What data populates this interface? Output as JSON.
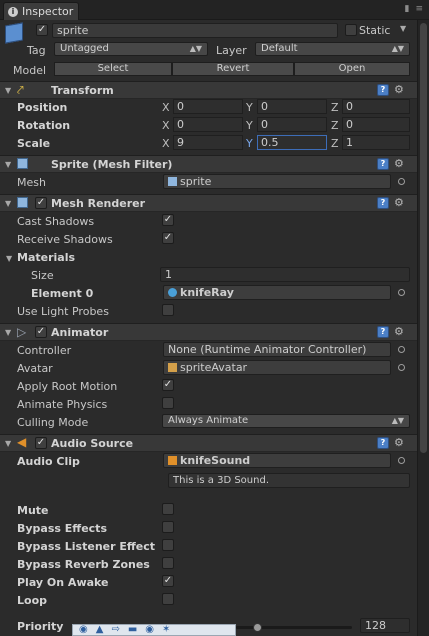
{
  "tab": {
    "title": "Inspector"
  },
  "object": {
    "name": "sprite",
    "active": true,
    "static_label": "Static",
    "static_checked": false,
    "tag_label": "Tag",
    "tag_value": "Untagged",
    "layer_label": "Layer",
    "layer_value": "Default",
    "model_label": "Model",
    "model_buttons": [
      "Select",
      "Revert",
      "Open"
    ]
  },
  "transform": {
    "title": "Transform",
    "position_label": "Position",
    "rotation_label": "Rotation",
    "scale_label": "Scale",
    "axes": [
      "X",
      "Y",
      "Z"
    ],
    "position": [
      "0",
      "0",
      "0"
    ],
    "rotation": [
      "0",
      "0",
      "0"
    ],
    "scale": [
      "9",
      "0.5",
      "1"
    ]
  },
  "mesh_filter": {
    "title": "Sprite (Mesh Filter)",
    "mesh_label": "Mesh",
    "mesh_value": "sprite"
  },
  "mesh_renderer": {
    "title": "Mesh Renderer",
    "enabled": true,
    "cast_shadows_label": "Cast Shadows",
    "cast_shadows": true,
    "receive_shadows_label": "Receive Shadows",
    "receive_shadows": true,
    "materials_label": "Materials",
    "size_label": "Size",
    "size_value": "1",
    "element0_label": "Element 0",
    "element0_value": "knifeRay",
    "light_probes_label": "Use Light Probes",
    "light_probes": false
  },
  "animator": {
    "title": "Animator",
    "enabled": true,
    "controller_label": "Controller",
    "controller_value": "None (Runtime Animator Controller)",
    "avatar_label": "Avatar",
    "avatar_value": "spriteAvatar",
    "apply_root_motion_label": "Apply Root Motion",
    "apply_root_motion": true,
    "animate_physics_label": "Animate Physics",
    "animate_physics": false,
    "culling_mode_label": "Culling Mode",
    "culling_mode_value": "Always Animate"
  },
  "audio_source": {
    "title": "Audio Source",
    "enabled": true,
    "audio_clip_label": "Audio Clip",
    "audio_clip_value": "knifeSound",
    "clip_info": "This is a 3D Sound.",
    "mute_label": "Mute",
    "mute": false,
    "bypass_effects_label": "Bypass Effects",
    "bypass_effects": false,
    "bypass_listener_label": "Bypass Listener Effect",
    "bypass_listener": false,
    "bypass_reverb_label": "Bypass Reverb Zones",
    "bypass_reverb": false,
    "play_on_awake_label": "Play On Awake",
    "play_on_awake": true,
    "loop_label": "Loop",
    "loop": false,
    "priority_label": "Priority",
    "priority_value": "128"
  },
  "icons": {
    "tab": "info-icon",
    "object": "cube-icon",
    "transform": "transform-axes-icon",
    "mesh_filter": "mesh-grid-icon",
    "mesh_renderer": "mesh-renderer-icon",
    "animator": "animator-icon",
    "audio_source": "speaker-icon",
    "help": "help-book-icon",
    "settings": "gear-icon"
  },
  "colors": {
    "background": "#2b2b2b",
    "header": "#383838",
    "accent_blue": "#79a5e6",
    "field": "#2e2e2e"
  }
}
